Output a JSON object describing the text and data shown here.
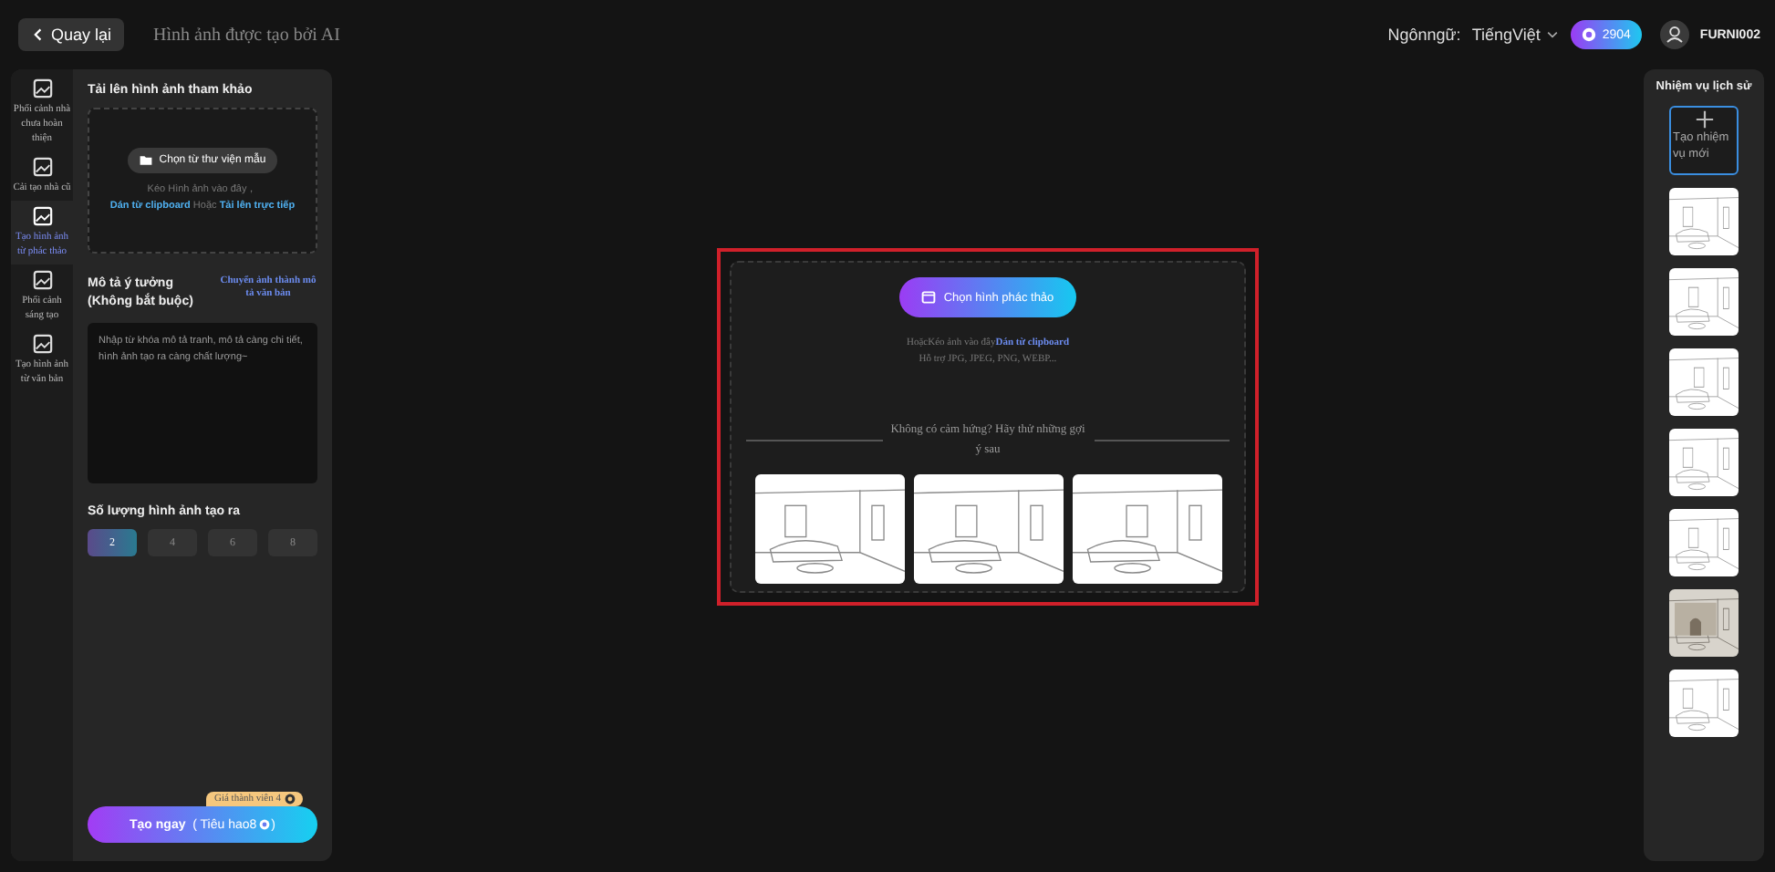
{
  "header": {
    "back_button": "Quay lại",
    "title": "Hình ảnh được tạo bởi AI",
    "language_label": "Ngônngữ:",
    "language_value": "TiếngViệt",
    "credits": "2904",
    "username": "FURNI002"
  },
  "nav": [
    {
      "label": "Phối cảnh nhà chưa hoàn thiện",
      "selected": false
    },
    {
      "label": "Cải tạo nhà cũ",
      "selected": false
    },
    {
      "label": "Tạo hình ảnh từ phác thảo",
      "selected": true
    },
    {
      "label": "Phối cảnh sáng tạo",
      "selected": false
    },
    {
      "label": "Tạo hình ảnh từ văn bản",
      "selected": false
    }
  ],
  "upload": {
    "title": "Tải lên hình ảnh tham khảo",
    "button": "Chọn từ thư viện mẫu",
    "hint": "Kéo Hình ảnh vào đây，",
    "paste_link": "Dán từ clipboard",
    "or": "Hoặc",
    "direct_link": "Tải lên trực tiếp"
  },
  "description": {
    "title": "Mô tả ý tưởng (Không bắt buộc)",
    "convert_link": "Chuyển ảnh thành mô tả văn bản",
    "placeholder": "Nhập từ khóa mô tả tranh, mô tả càng chi tiết, hình ảnh tạo ra càng chất lượng~"
  },
  "count": {
    "title": "Số lượng hình ảnh tạo ra",
    "options": [
      {
        "label": "2",
        "selected": true
      },
      {
        "label": "4",
        "selected": false
      },
      {
        "label": "6",
        "selected": false
      },
      {
        "label": "8",
        "selected": false
      }
    ]
  },
  "generate": {
    "badge": "Giá thành viên 4",
    "button": "Tạo ngay",
    "cost": "( Tiêu hao8",
    "cost_end": ")"
  },
  "sketch_upload": {
    "button": "Chọn hình phác thảo",
    "hint": "HoặcKéo ảnh vào đây",
    "paste_link": "Dán từ clipboard",
    "formats": "Hỗ trợ JPG, JPEG, PNG, WEBP...",
    "inspiration": "Không có cảm hứng? Hãy thử những gợi ý sau",
    "suggestions": [
      {
        "kind": "sketch"
      },
      {
        "kind": "sketch"
      },
      {
        "kind": "sketch"
      }
    ]
  },
  "history": {
    "title": "Nhiệm vụ lịch sử",
    "new_task": "Tạo nhiệm vụ mới",
    "items": [
      {
        "kind": "sketch"
      },
      {
        "kind": "sketch"
      },
      {
        "kind": "sketch"
      },
      {
        "kind": "sketch"
      },
      {
        "kind": "sketch"
      },
      {
        "kind": "render"
      },
      {
        "kind": "sketch"
      }
    ]
  }
}
